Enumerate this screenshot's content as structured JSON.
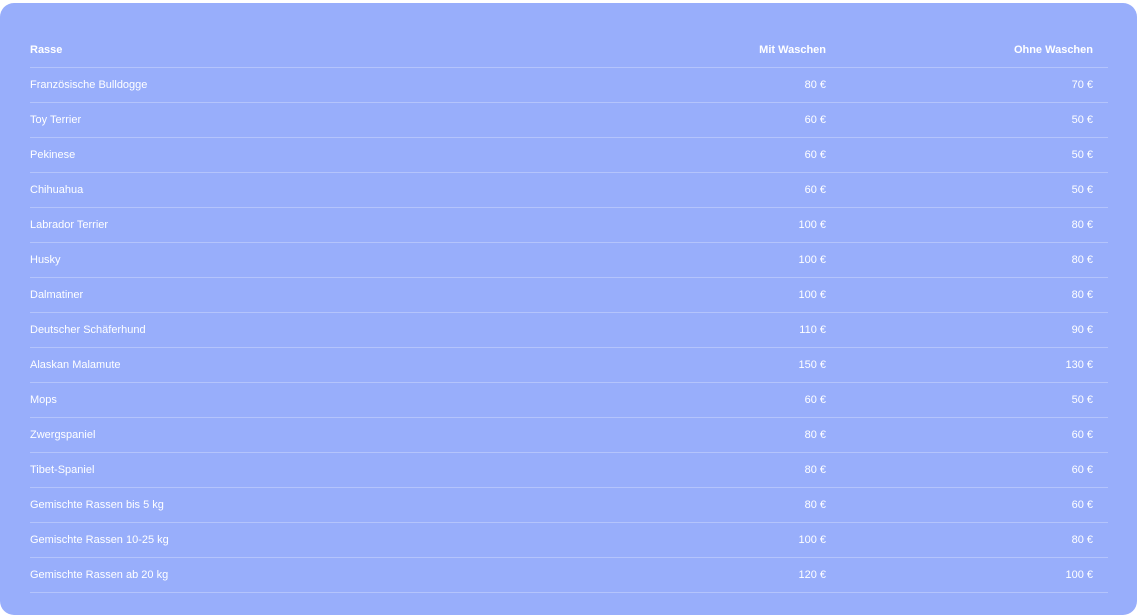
{
  "table": {
    "headers": {
      "breed": "Rasse",
      "with_wash": "Mit Waschen",
      "without_wash": "Ohne Waschen"
    },
    "rows": [
      {
        "breed": "Französische Bulldogge",
        "with_wash": "80 €",
        "without_wash": "70 €"
      },
      {
        "breed": "Toy Terrier",
        "with_wash": "60 €",
        "without_wash": "50 €"
      },
      {
        "breed": "Pekinese",
        "with_wash": "60 €",
        "without_wash": "50 €"
      },
      {
        "breed": "Chihuahua",
        "with_wash": "60 €",
        "without_wash": "50 €"
      },
      {
        "breed": "Labrador Terrier",
        "with_wash": "100 €",
        "without_wash": "80 €"
      },
      {
        "breed": "Husky",
        "with_wash": "100 €",
        "without_wash": "80 €"
      },
      {
        "breed": "Dalmatiner",
        "with_wash": "100 €",
        "without_wash": "80 €"
      },
      {
        "breed": "Deutscher Schäferhund",
        "with_wash": "110 €",
        "without_wash": "90 €"
      },
      {
        "breed": "Alaskan Malamute",
        "with_wash": "150 €",
        "without_wash": "130 €"
      },
      {
        "breed": "Mops",
        "with_wash": "60 €",
        "without_wash": "50 €"
      },
      {
        "breed": "Zwergspaniel",
        "with_wash": "80 €",
        "without_wash": "60 €"
      },
      {
        "breed": "Tibet-Spaniel",
        "with_wash": "80 €",
        "without_wash": "60 €"
      },
      {
        "breed": "Gemischte Rassen bis 5 kg",
        "with_wash": "80 €",
        "without_wash": "60 €"
      },
      {
        "breed": "Gemischte Rassen 10-25 kg",
        "with_wash": "100 €",
        "without_wash": "80 €"
      },
      {
        "breed": "Gemischte Rassen ab 20 kg",
        "with_wash": "120 €",
        "without_wash": "100 €"
      }
    ]
  },
  "colors": {
    "card_background": "#98aefb",
    "text": "#ffffff"
  }
}
